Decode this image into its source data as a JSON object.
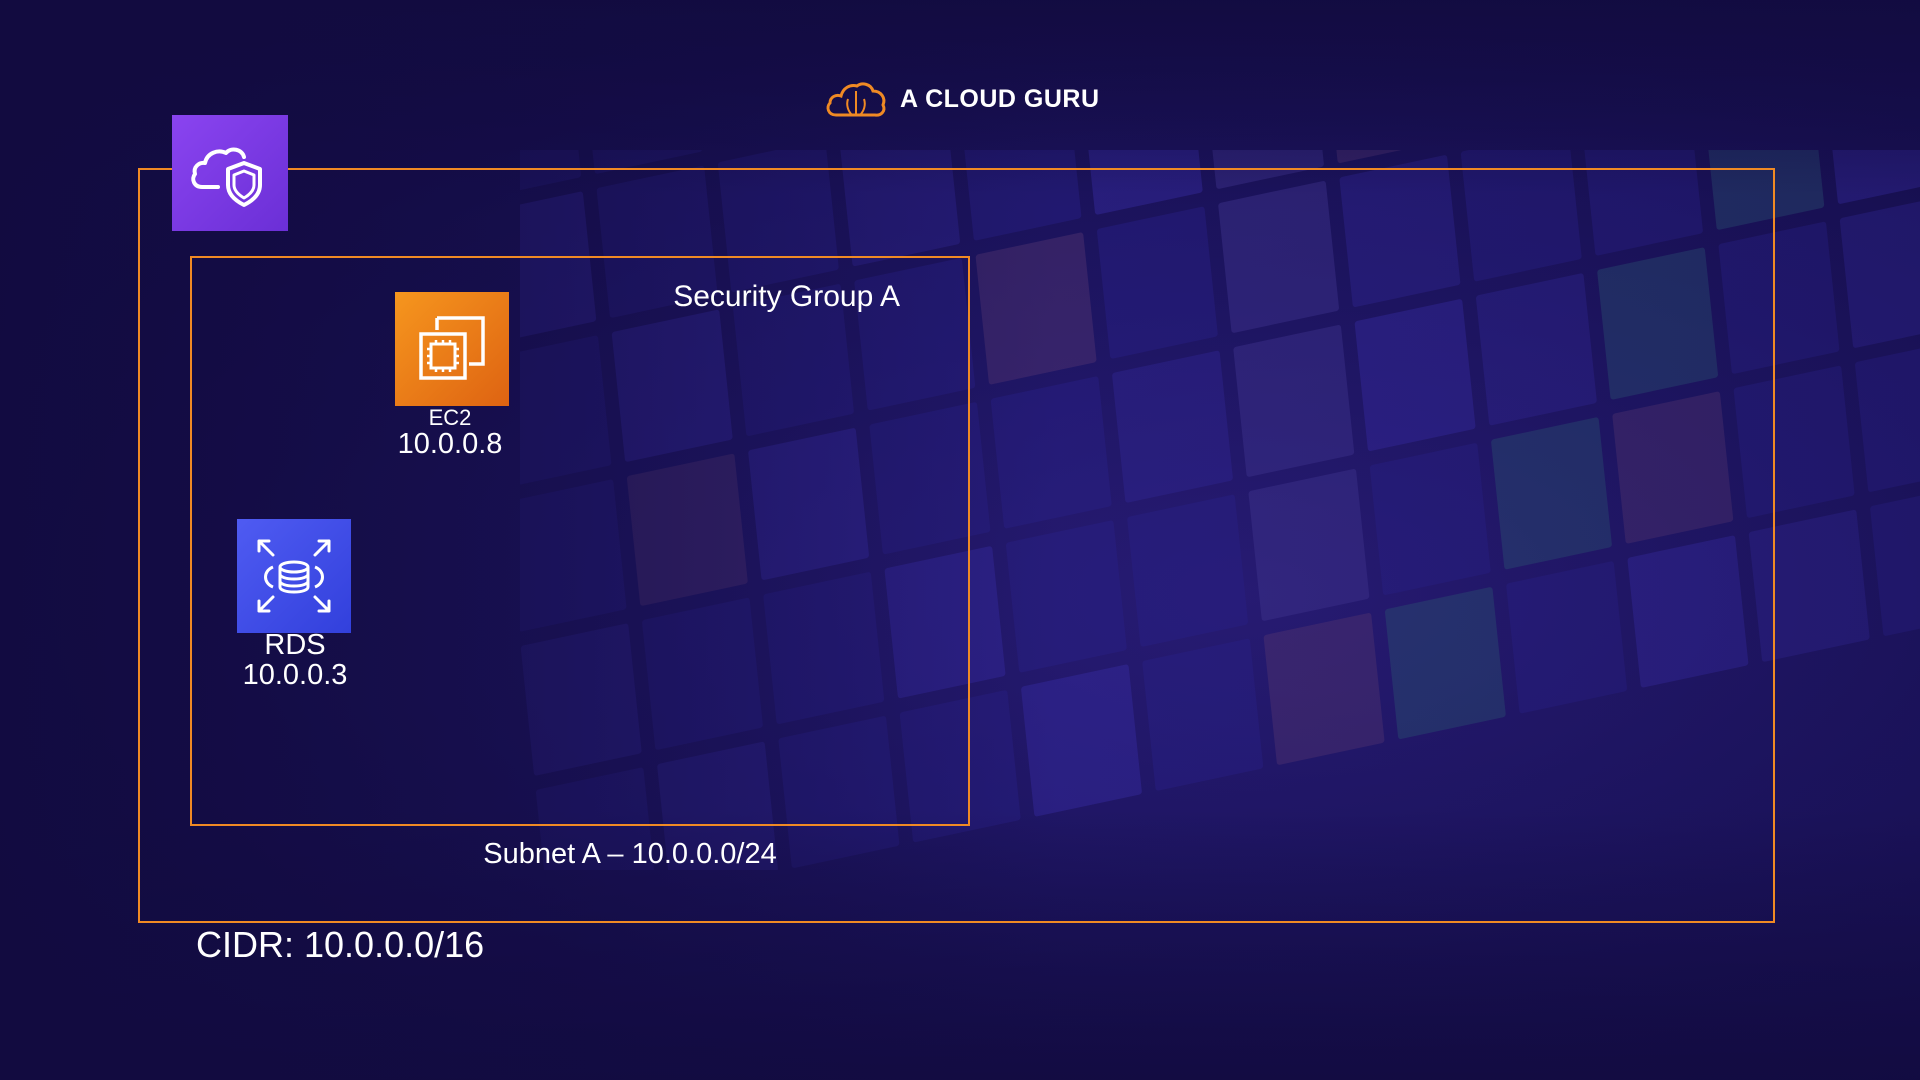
{
  "brand": {
    "name": "A CLOUD GURU",
    "icon": "cloud-logo-icon",
    "color": "#f08a24"
  },
  "vpc": {
    "icon": "vpc-cloud-shield-icon",
    "cidr_label": "CIDR: 10.0.0.0/16",
    "border_color": "#f08a24"
  },
  "subnet": {
    "label": "Subnet A – 10.0.0.0/24"
  },
  "security_group": {
    "label": "Security Group A"
  },
  "ec2": {
    "icon": "ec2-chip-icon",
    "name": "EC2",
    "ip": "10.0.0.8",
    "color": "#f08a24"
  },
  "rds": {
    "icon": "rds-database-icon",
    "name": "RDS",
    "ip": "10.0.0.3",
    "color": "#3f4ce6"
  }
}
